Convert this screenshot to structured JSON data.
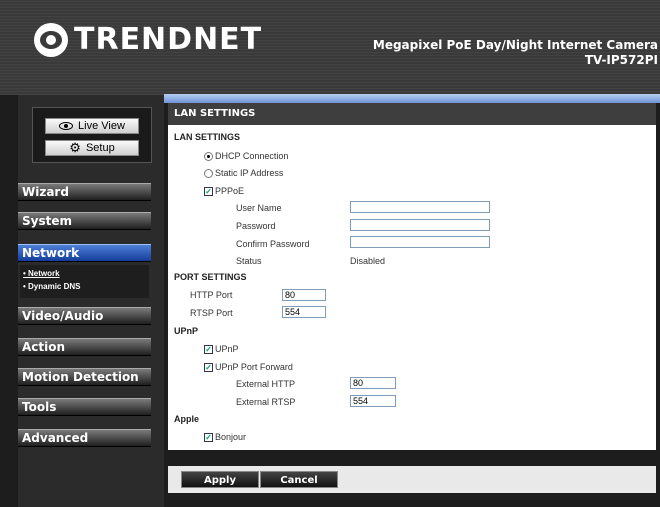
{
  "header": {
    "brand": "TRENDNET",
    "product_line1": "Megapixel PoE Day/Night Internet Camera",
    "product_line2": "TV-IP572PI"
  },
  "quick_buttons": {
    "live_view": "Live View",
    "setup": "Setup"
  },
  "nav": {
    "wizard": "Wizard",
    "system": "System",
    "network": "Network",
    "sub_network": "• Network",
    "sub_ddns": "• Dynamic DNS",
    "video_audio": "Video/Audio",
    "action": "Action",
    "motion": "Motion Detection",
    "tools": "Tools",
    "advanced": "Advanced"
  },
  "panel_title": "LAN SETTINGS",
  "lan": {
    "heading": "LAN SETTINGS",
    "dhcp": "DHCP Connection",
    "static": "Static IP Address",
    "pppoe": "PPPoE",
    "user_name": "User Name",
    "password": "Password",
    "confirm_password": "Confirm Password",
    "status_label": "Status",
    "status_value": "Disabled",
    "user_name_value": "",
    "password_value": "",
    "confirm_value": ""
  },
  "ports": {
    "heading": "PORT SETTINGS",
    "http_label": "HTTP Port",
    "http_value": "80",
    "rtsp_label": "RTSP Port",
    "rtsp_value": "554"
  },
  "upnp": {
    "heading": "UPnP",
    "upnp": "UPnP",
    "port_forward": "UPnP Port Forward",
    "ext_http_label": "External HTTP",
    "ext_http_value": "80",
    "ext_rtsp_label": "External RTSP",
    "ext_rtsp_value": "554"
  },
  "apple": {
    "heading": "Apple",
    "bonjour": "Bonjour"
  },
  "footer": {
    "apply": "Apply",
    "cancel": "Cancel"
  },
  "colors": {
    "active_nav": "#2a5bc0",
    "header_bg": "#3a3a3a"
  }
}
